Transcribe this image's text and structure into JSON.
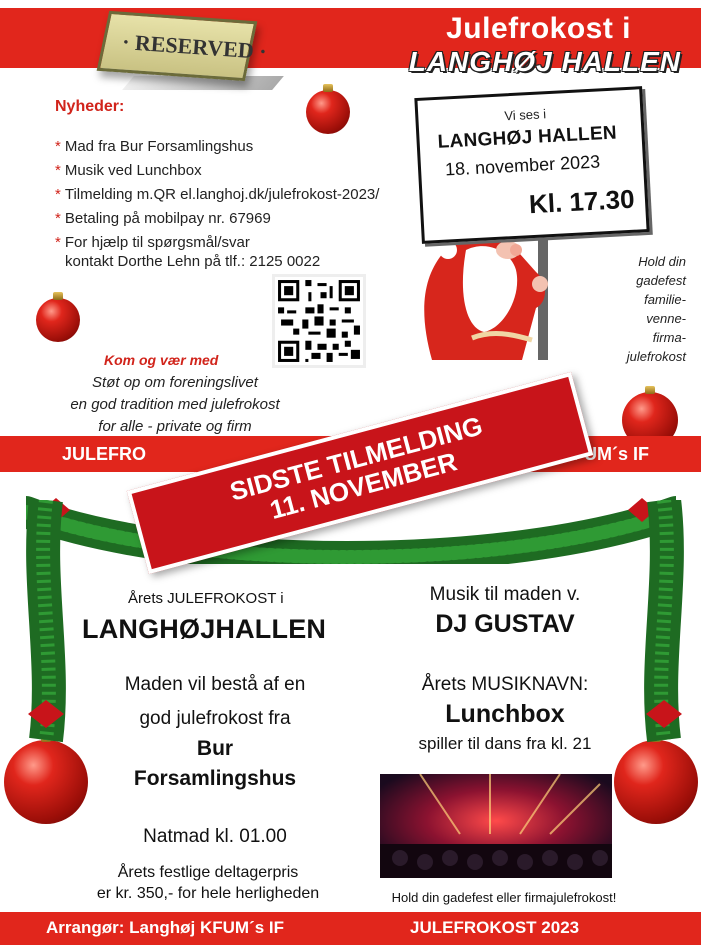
{
  "header": {
    "title_line1": "Julefrokost i",
    "title_line2": "LANGHØJ HALLEN",
    "reserved": "· RESERVED ·"
  },
  "news": {
    "title": "Nyheder:",
    "items": [
      "Mad fra Bur Forsamlingshus",
      "Musik ved Lunchbox",
      "Tilmelding m.QR el.langhoj.dk/julefrokost-2023/",
      "Betaling på mobilpay nr. 67969",
      "For hjælp til spørgsmål/svar",
      "kontakt Dorthe Lehn på tlf.: 2125 0022"
    ]
  },
  "come": {
    "title": "Kom og vær med",
    "lines": [
      "Støt op om foreningslivet",
      "en god tradition med julefrokost",
      "for alle - private og firm"
    ]
  },
  "sign": {
    "vises": "Vi ses i",
    "hallen": "LANGHØJ HALLEN",
    "date": "18. november 2023",
    "time": "Kl. 17.30"
  },
  "hold": {
    "lines": [
      "Hold din",
      "gadefest",
      "familie-",
      "venne-",
      "firma-",
      "julefrokost"
    ]
  },
  "mid_band": {
    "left": "JULEFRO",
    "right": "KFUM´s IF"
  },
  "banner": {
    "line1": "SIDSTE TILMELDING",
    "line2": "11. NOVEMBER"
  },
  "left_col": {
    "title": "Årets JULEFROKOST i",
    "hallen": "LANGHØJHALLEN",
    "maden_line1": "Maden vil bestå af en",
    "maden_line2": "god julefrokost fra",
    "bur_line1": "Bur",
    "bur_line2": "Forsamlingshus",
    "natmad": "Natmad kl. 01.00",
    "pris_line1": "Årets festlige deltagerpris",
    "pris_line2": "er kr. 350,- for hele herligheden"
  },
  "right_col": {
    "musik": "Musik til maden v.",
    "dj": "DJ GUSTAV",
    "aars_musik": "Årets MUSIKNAVN:",
    "lunchbox": "Lunchbox",
    "spiller": "spiller til dans fra kl. 21",
    "caption": "Hold din gadefest eller firmajulefrokost!"
  },
  "footer": {
    "left": "Arrangør: Langhøj KFUM´s IF",
    "right": "JULEFROKOST 2023"
  },
  "colors": {
    "brand_red": "#e1261c",
    "banner_red": "#c8141a"
  }
}
